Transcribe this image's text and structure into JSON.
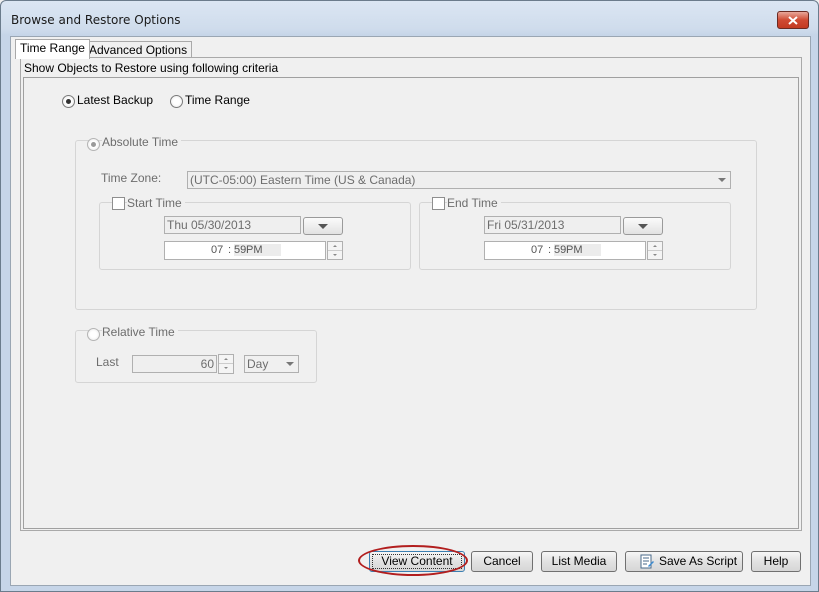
{
  "window": {
    "title": "Browse and Restore Options"
  },
  "tabs": [
    {
      "label": "Time Range",
      "active": true
    },
    {
      "label": "Advanced Options",
      "active": false
    }
  ],
  "criteria_label": "Show Objects to Restore using following criteria",
  "mode": {
    "latest_backup_label": "Latest Backup",
    "time_range_label": "Time Range",
    "selected": "Latest Backup"
  },
  "absolute_time": {
    "label": "Absolute Time",
    "time_zone_label": "Time Zone:",
    "time_zone_value": "(UTC-05:00) Eastern Time (US & Canada)",
    "start": {
      "label": "Start Time",
      "date": "Thu 05/30/2013",
      "hour": "07",
      "sep": ":",
      "minute": "59",
      "ampm": "PM"
    },
    "end": {
      "label": "End Time",
      "date": "Fri 05/31/2013",
      "hour": "07",
      "sep": ":",
      "minute": "59",
      "ampm": "PM"
    }
  },
  "relative_time": {
    "label": "Relative Time",
    "last_label": "Last",
    "value": "60",
    "unit": "Day"
  },
  "buttons": {
    "view_content": "View Content",
    "cancel": "Cancel",
    "list_media": "List Media",
    "save_as_script": "Save As Script",
    "help": "Help"
  },
  "colors": {
    "highlight_ring": "#b21e1e",
    "close_button": "#c33a22"
  }
}
